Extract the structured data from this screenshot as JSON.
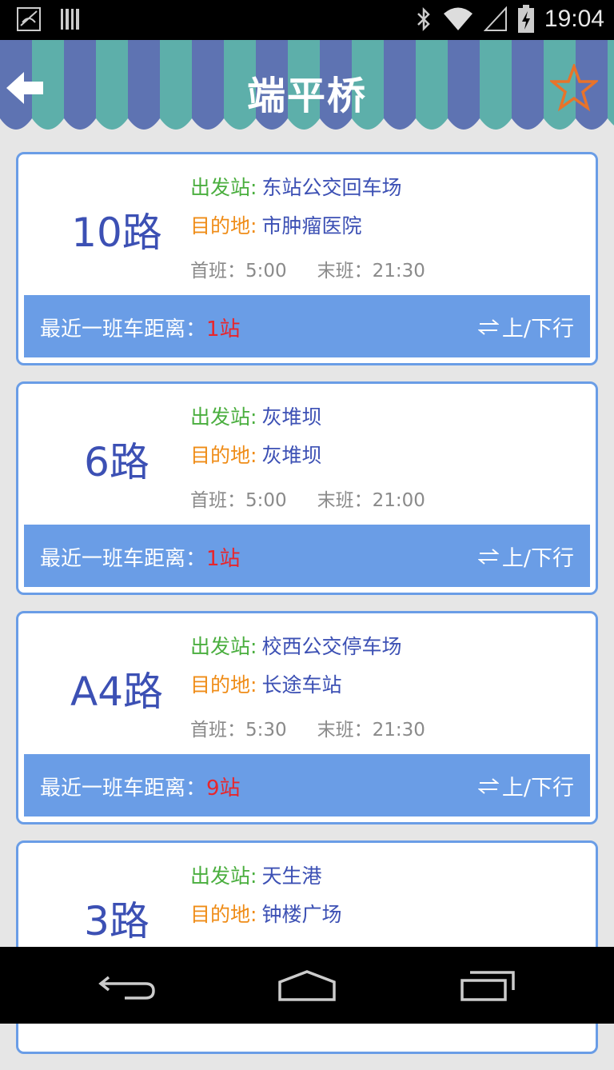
{
  "status_bar": {
    "time": "19:04",
    "icons": [
      "notification-icon",
      "barcode-icon",
      "bluetooth-icon",
      "wifi-icon",
      "signal-icon",
      "battery-charging-icon"
    ]
  },
  "header": {
    "title": "端平桥",
    "back_icon": "back-arrow-icon",
    "favorite_icon": "star-outline-icon",
    "colors": {
      "stripe_blue": "#5e73b2",
      "stripe_teal": "#5dafaa",
      "star": "#e8732a"
    }
  },
  "routes": [
    {
      "name": "10路",
      "start_label": "出发站:",
      "start": "东站公交回车场",
      "dest_label": "目的地:",
      "dest": "市肿瘤医院",
      "first_label": "首班：",
      "first": "5:00",
      "last_label": "末班：",
      "last": "21:30",
      "distance_label": "最近一班车距离：",
      "distance": "1站",
      "direction": "上/下行"
    },
    {
      "name": "6路",
      "start_label": "出发站:",
      "start": "灰堆坝",
      "dest_label": "目的地:",
      "dest": "灰堆坝",
      "first_label": "首班：",
      "first": "5:00",
      "last_label": "末班：",
      "last": "21:00",
      "distance_label": "最近一班车距离：",
      "distance": "1站",
      "direction": "上/下行"
    },
    {
      "name": "A4路",
      "start_label": "出发站:",
      "start": "校西公交停车场",
      "dest_label": "目的地:",
      "dest": "长途车站",
      "first_label": "首班：",
      "first": "5:30",
      "last_label": "末班：",
      "last": "21:30",
      "distance_label": "最近一班车距离：",
      "distance": "9站",
      "direction": "上/下行"
    },
    {
      "name": "3路",
      "start_label": "出发站:",
      "start": "天生港",
      "dest_label": "目的地:",
      "dest": "钟楼广场"
    }
  ],
  "nav_bar": {
    "icons": [
      "back-nav-icon",
      "home-nav-icon",
      "recents-nav-icon"
    ]
  }
}
